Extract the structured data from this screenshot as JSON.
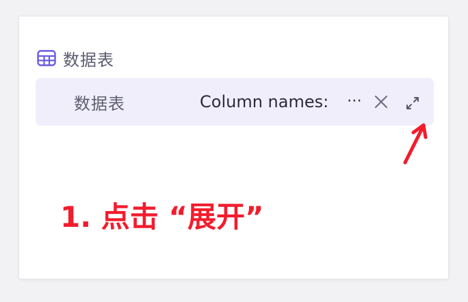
{
  "section": {
    "title": "数据表",
    "icon": "table-icon",
    "accent_color": "#6a5ae0"
  },
  "field": {
    "label": "数据表",
    "value": "Column names: ",
    "ellipsis": "⋯",
    "clear_icon": "close-icon",
    "expand_icon": "expand-icon"
  },
  "annotation": {
    "text": "1. 点击 “展开”",
    "color": "#f21c2d"
  }
}
